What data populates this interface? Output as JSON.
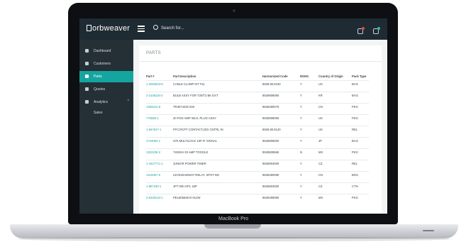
{
  "device": {
    "label": "MacBook Pro"
  },
  "topbar": {
    "logo": "orbweaver",
    "search_label": "Search for..."
  },
  "sidebar": {
    "items": [
      {
        "label": "Dashboard",
        "icon": "home-icon"
      },
      {
        "label": "Customers",
        "icon": "user-icon"
      },
      {
        "label": "Parts",
        "icon": "gear-icon",
        "active": true
      },
      {
        "label": "Quotes",
        "icon": "document-icon"
      },
      {
        "label": "Analytics",
        "icon": "chart-icon"
      }
    ],
    "sub_items": [
      {
        "label": "Sales"
      }
    ]
  },
  "main": {
    "title": "PARTS",
    "columns": [
      "Part #",
      "Part Description",
      "Harmonized Code",
      "ROHS",
      "Country of Origin",
      "Pack Type"
    ],
    "rows": [
      [
        "1-2092623-8",
        "CABLE CLAMP KIT #11",
        "8536.90.8160",
        "Y",
        "US",
        "BAG"
      ],
      [
        "2-2106118-2",
        "BULB ASSY FOR T25/T2 BK EXT",
        "8536908080",
        "Y",
        "KR",
        "BAG"
      ],
      [
        "1393212-8",
        "TR3074220 040",
        "8536490076",
        "Y",
        "CN",
        "PKG"
      ],
      [
        "770580-1",
        "20 POS AMP SEAL PLUG ASSY",
        "8536906090",
        "Y",
        "US",
        "PKG"
      ],
      [
        "1-667547-1",
        "FFC;RCPT CONTACT,20G CNTRL IN",
        "8536.90.8140",
        "Y",
        "US",
        "REL"
      ],
      [
        "1744064-1",
        "S75 MULTILOCK 10P IF SIGNAL",
        "8536906000",
        "Y",
        "JP",
        "BAG"
      ],
      [
        "1322236-2",
        "7402KH 20 AMP TOGGLE",
        "8536508565",
        "N",
        "MX",
        "PKG"
      ],
      [
        "1-1627771-1",
        "JUNIOR POWER TIMER",
        "8536904000",
        "Y",
        "CZ",
        "REL"
      ],
      [
        "1419367-6",
        "LEV0S0AMNAF-RELAY, SPST-NO",
        "8536490090",
        "Y",
        "CN",
        "BOX,"
      ],
      [
        "1-967240-1",
        "JPT 00H KPL 16P",
        "8536904000",
        "Y",
        "CZ",
        "CTN"
      ],
      [
        "2-6439134-1",
        "PEL8055SKO-012W",
        "8536499090",
        "Y",
        "MX",
        "PKG"
      ]
    ]
  },
  "colors": {
    "accent": "#15a5a0",
    "sidebar_bg": "#252f36",
    "topbar_bg": "#1f2b33",
    "notification_red": "#e8473f",
    "notification_teal": "#1fc1b4"
  }
}
